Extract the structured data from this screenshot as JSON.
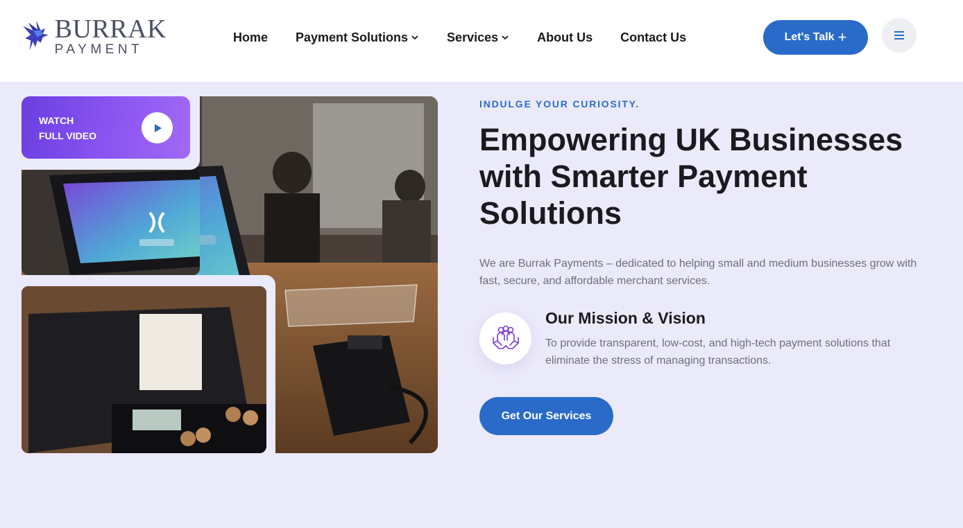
{
  "brand": {
    "name_line1": "BURRAK",
    "name_line2": "PAYMENT",
    "logo_icon": "pegasus-icon",
    "accent": "#2a6bc9"
  },
  "nav": {
    "items": [
      {
        "label": "Home"
      },
      {
        "label": "Payment Solutions",
        "icon": "chevron-down-icon"
      },
      {
        "label": "Services",
        "icon": "chevron-down-icon"
      },
      {
        "label": "About Us"
      },
      {
        "label": "Contact Us"
      }
    ],
    "cta_label": "Let's Talk",
    "cta_icon": "plus-icon",
    "menu_icon": "hamburger-menu-icon"
  },
  "hero": {
    "video": {
      "line1": "WATCH",
      "line2": "FULL VIDEO",
      "icon": "play-icon"
    },
    "eyebrow": "INDULGE YOUR CURIOSITY.",
    "headline_line1": "Empowering UK Businesses",
    "headline_line2": "with Smarter Payment",
    "headline_line3": "Solutions",
    "intro": "We are Burrak Payments – dedicated to helping small and medium businesses grow with fast, secure, and affordable merchant services.",
    "mission": {
      "icon": "hands-people-icon",
      "title": "Our Mission & Vision",
      "text": "To provide transparent, low-cost, and high-tech payment solutions that eliminate the stress of managing transactions."
    },
    "cta_label": "Get Our Services"
  },
  "colors": {
    "page_bg": "#ebeafb",
    "primary": "#2a6bc9",
    "video_card": "#8c55f2",
    "heading": "#1a1a1f",
    "body_text": "#6e6e7a"
  }
}
